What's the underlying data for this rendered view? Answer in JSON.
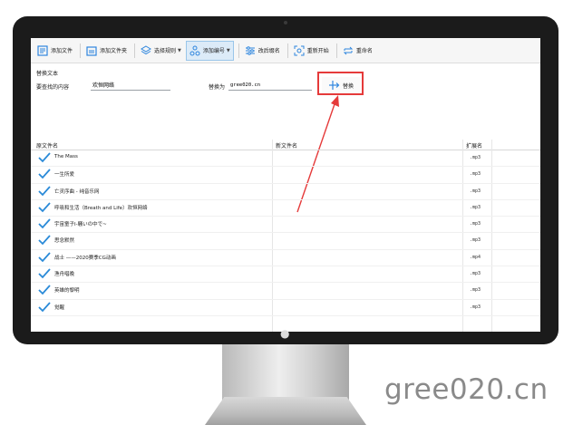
{
  "toolbar": {
    "add_file": "添加文件",
    "add_folder": "添加文件夹",
    "select_rule": "选择规则",
    "add_number": "添加编号",
    "change_post": "改后缀名",
    "restart": "重新开始",
    "rename": "重命名"
  },
  "replace_panel": {
    "group_label": "替换文本",
    "find_label": "要查找的内容",
    "find_value": "欢恒网络",
    "replace_label": "替换为",
    "replace_value": "gree020.cn",
    "replace_button": "替换"
  },
  "columns": {
    "original": "原文件名",
    "new": "新文件名",
    "ext": "扩展名"
  },
  "files": [
    {
      "name": "The Mass",
      "ext": ".mp3"
    },
    {
      "name": "一生所爱",
      "ext": ".mp3"
    },
    {
      "name": "亡灵序曲 - 纯音乐网",
      "ext": ".mp3"
    },
    {
      "name": "呼吸和生活（Breath and Life）欢恒网络",
      "ext": ".mp3"
    },
    {
      "name": "宇宙童子I-騒いの中で~",
      "ext": ".mp3"
    },
    {
      "name": "思念默然",
      "ext": ".mp3"
    },
    {
      "name": "战士 ——2020赛季CG动画",
      "ext": ".mp4"
    },
    {
      "name": "渔舟唱晚",
      "ext": ".mp3"
    },
    {
      "name": "英雄的黎明",
      "ext": ".mp3"
    },
    {
      "name": "觉醒",
      "ext": ".mp3"
    }
  ],
  "watermark": "gree020.cn",
  "colors": {
    "accent": "#2e86de",
    "highlight": "#e53a3a",
    "check": "#2a8ad8"
  }
}
